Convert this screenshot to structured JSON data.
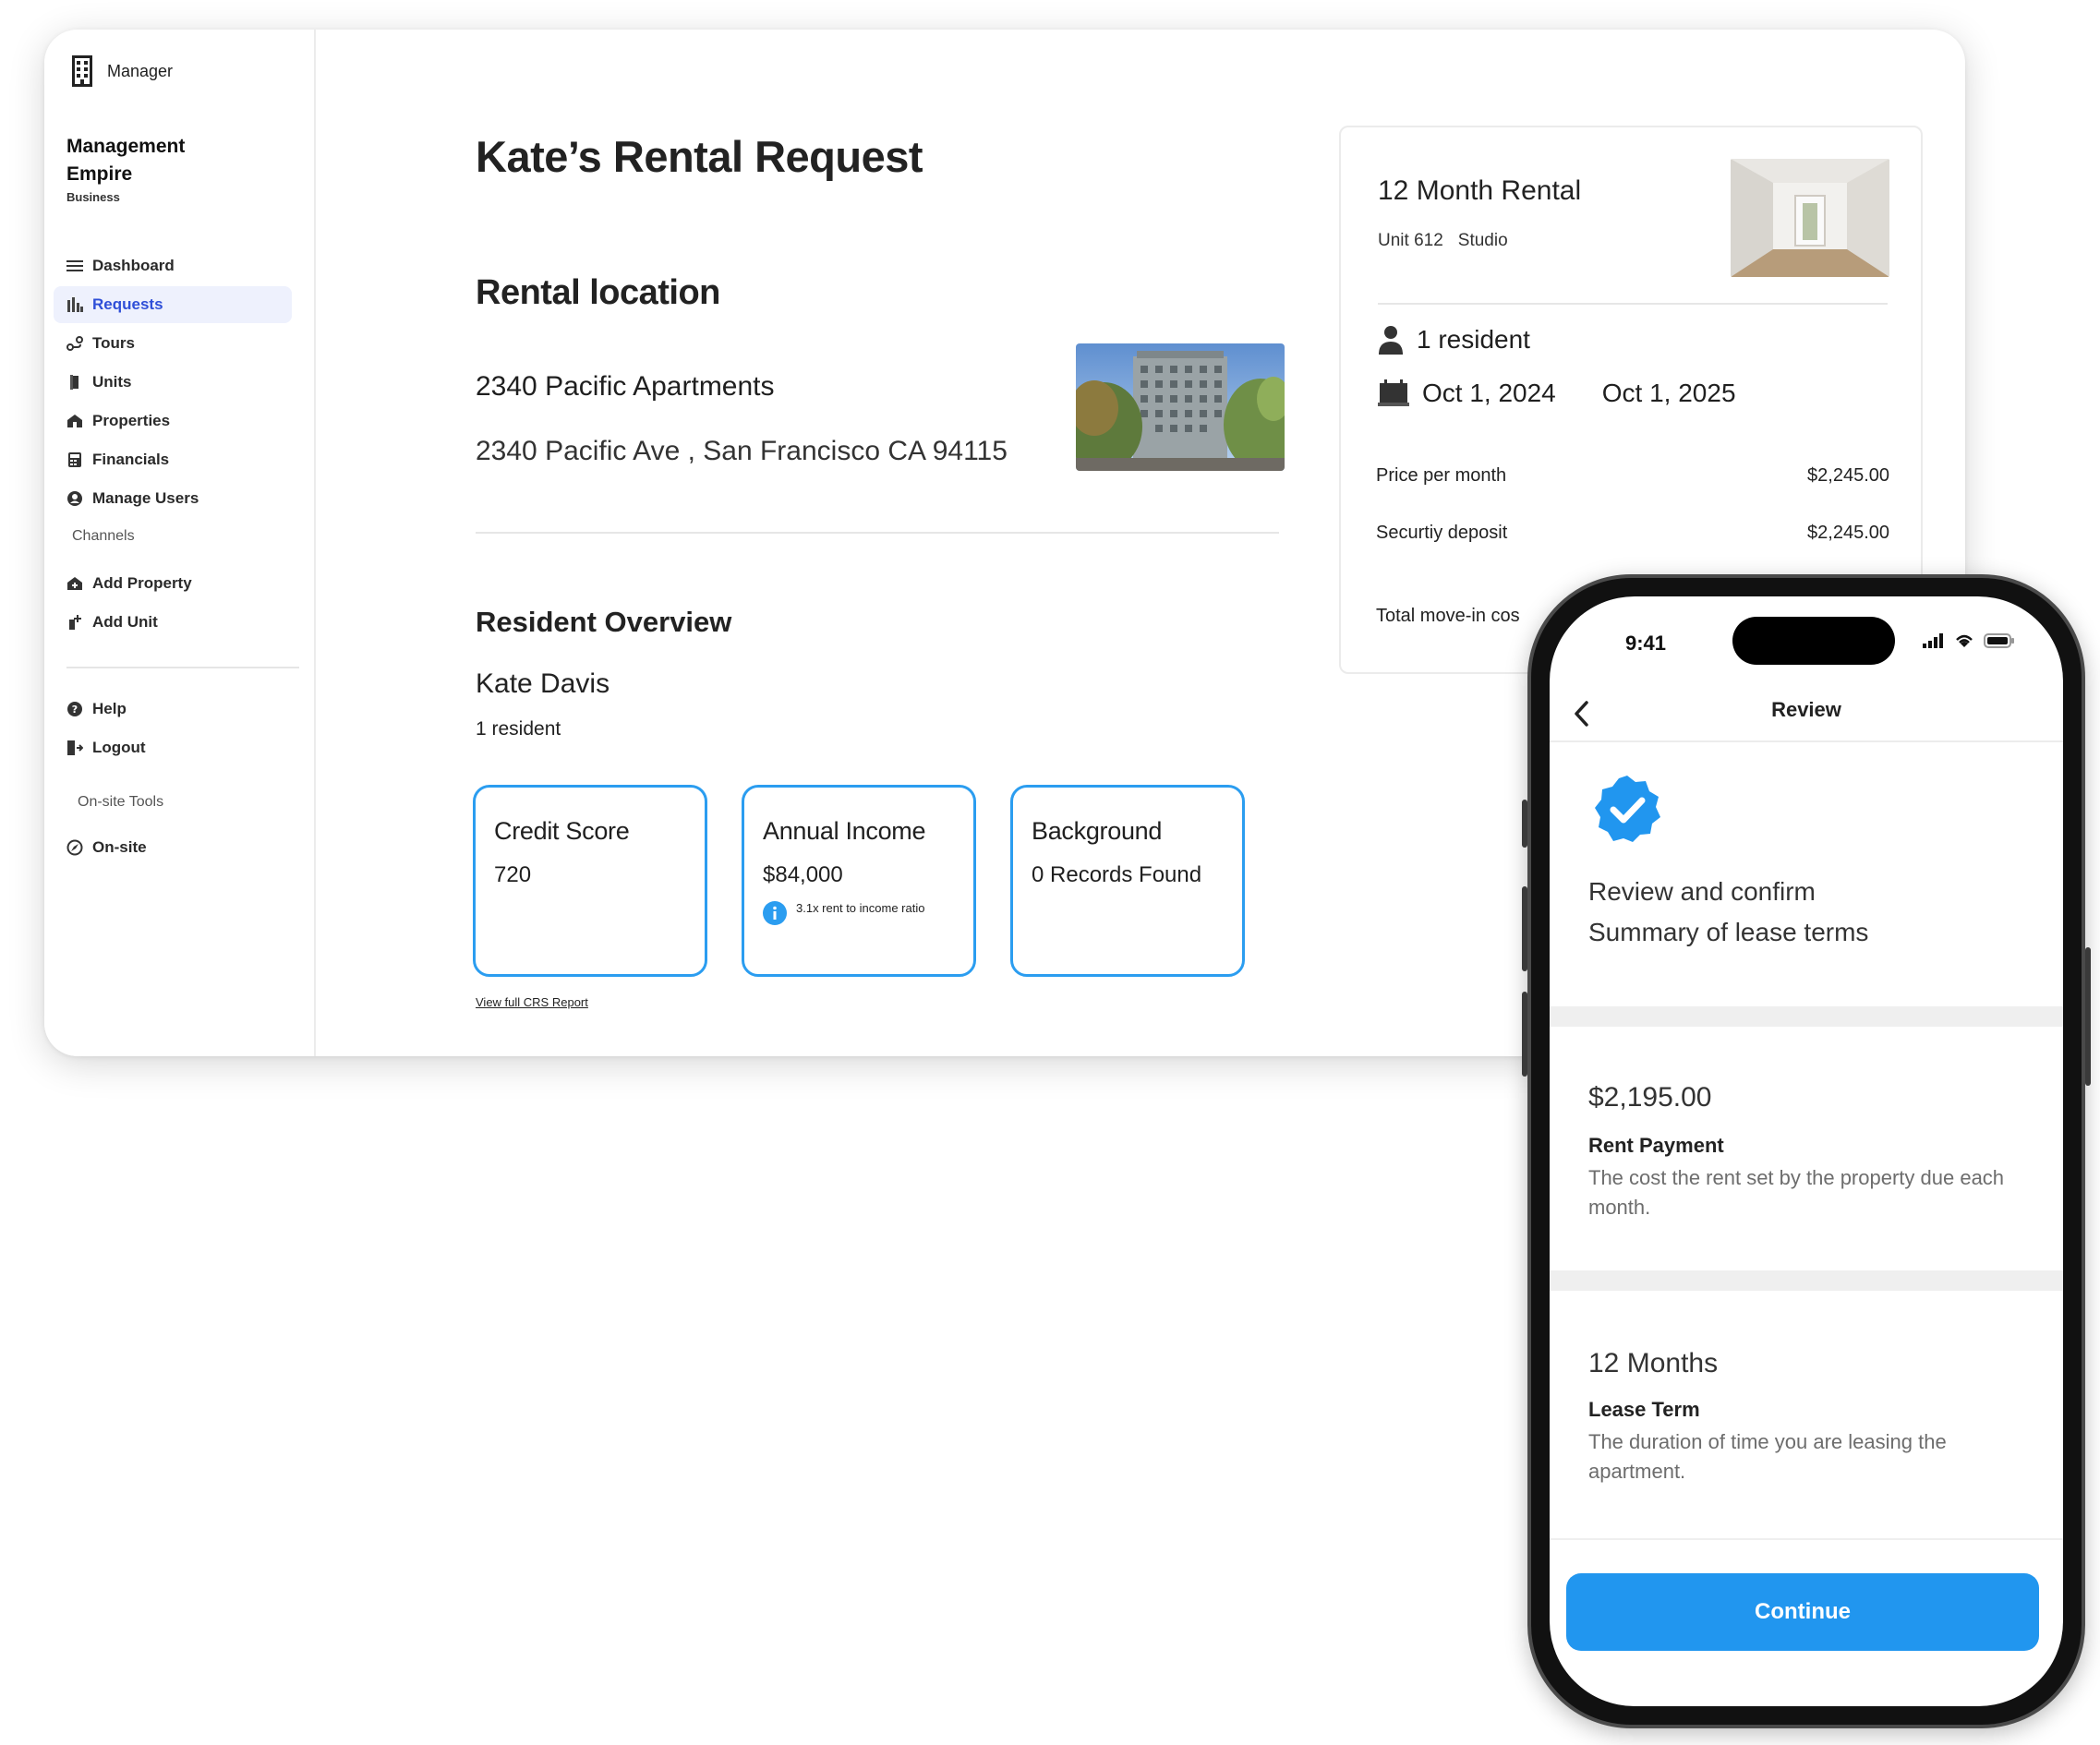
{
  "sidebar": {
    "brand": "Manager",
    "company_name": "Management Empire",
    "company_type": "Business",
    "nav": [
      {
        "label": "Dashboard",
        "icon": "menu-icon"
      },
      {
        "label": "Requests",
        "icon": "bar-chart-icon",
        "active": true
      },
      {
        "label": "Tours",
        "icon": "route-icon"
      },
      {
        "label": "Units",
        "icon": "door-icon"
      },
      {
        "label": "Properties",
        "icon": "home-icon"
      },
      {
        "label": "Financials",
        "icon": "calculator-icon"
      },
      {
        "label": "Manage Users",
        "icon": "user-circle-icon"
      }
    ],
    "channels_label": "Channels",
    "channels": [
      {
        "label": "Add Property",
        "icon": "add-home-icon"
      },
      {
        "label": "Add Unit",
        "icon": "add-unit-icon"
      }
    ],
    "footer": [
      {
        "label": "Help",
        "icon": "help-icon"
      },
      {
        "label": "Logout",
        "icon": "logout-icon"
      }
    ],
    "tools_label": "On-site Tools",
    "tools": [
      {
        "label": "On-site",
        "icon": "compass-icon"
      }
    ]
  },
  "main": {
    "title": "Kate’s Rental Request",
    "location_heading": "Rental location",
    "apartment_name": "2340 Pacific Apartments",
    "apartment_address": "2340 Pacific Ave , San Francisco CA 94115",
    "overview_heading": "Resident Overview",
    "resident_name": "Kate Davis",
    "resident_count": "1 resident",
    "cards": [
      {
        "title": "Credit Score",
        "value": "720"
      },
      {
        "title": "Annual Income",
        "value": "$84,000",
        "note": "3.1x rent to income ratio"
      },
      {
        "title": "Background",
        "value": "0 Records Found"
      }
    ],
    "crs_link": "View full CRS Report"
  },
  "summary": {
    "title": "12 Month Rental",
    "unit": "Unit 612",
    "unit_type": "Studio",
    "residents": "1 resident",
    "start_date": "Oct 1, 2024",
    "end_date": "Oct 1, 2025",
    "price_label": "Price per month",
    "price_value": "$2,245.00",
    "deposit_label": "Securtiy deposit",
    "deposit_value": "$2,245.00",
    "total_label": "Total move-in cos"
  },
  "phone": {
    "time": "9:41",
    "nav_title": "Review",
    "intro_line1": "Review and confirm",
    "intro_line2": "Summary of lease terms",
    "rent_value": "$2,195.00",
    "rent_label": "Rent Payment",
    "rent_desc": "The cost the rent set by the property due each month.",
    "term_value": "12 Months",
    "term_label": "Lease Term",
    "term_desc": "The duration of time you are leasing the apartment.",
    "continue_label": "Continue"
  },
  "colors": {
    "accent": "#2b9df0",
    "button": "#2196ef",
    "active_nav_bg": "#eef1fd",
    "active_nav_text": "#2f4fd8"
  }
}
